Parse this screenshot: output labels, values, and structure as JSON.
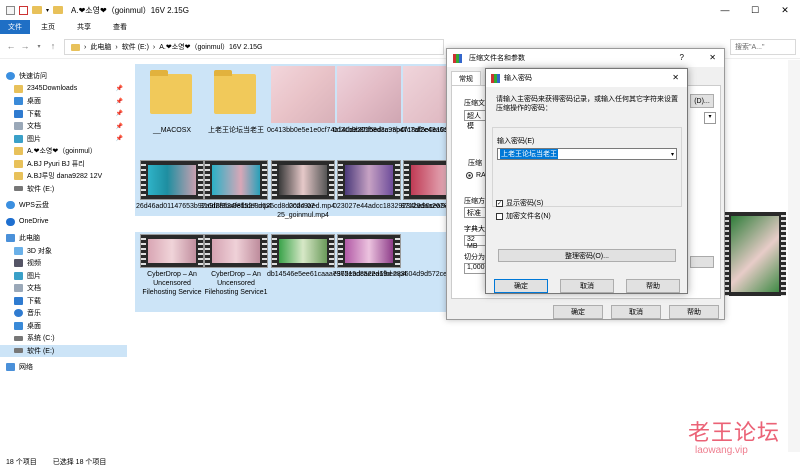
{
  "window": {
    "title": "A.❤소영❤（goinmul）16V 2.15G",
    "minimize": "—",
    "maximize": "☐",
    "close": "✕"
  },
  "ribbon": {
    "tabs": [
      "文件",
      "主页",
      "共享",
      "查看"
    ]
  },
  "address": {
    "path": [
      "此电脑",
      "软件 (E:)",
      "A.❤소영❤（goinmul）16V 2.15G"
    ],
    "search_placeholder": "搜索\"A...\""
  },
  "sidebar": {
    "items": [
      {
        "label": "快速访问",
        "pinned": false
      },
      {
        "label": "2345Downloads",
        "pinned": true
      },
      {
        "label": "桌面",
        "pinned": true
      },
      {
        "label": "下载",
        "pinned": true
      },
      {
        "label": "文档",
        "pinned": true
      },
      {
        "label": "图片",
        "pinned": true
      },
      {
        "label": "A.❤소영❤（goinmul）",
        "pinned": false
      },
      {
        "label": "A.BJ Pyuri BJ 퓨리",
        "pinned": false
      },
      {
        "label": "A.BJ루밍 dana9282 12V",
        "pinned": false
      },
      {
        "label": "软件 (E:)",
        "pinned": false
      },
      {
        "label": "WPS云盘",
        "pinned": false
      },
      {
        "label": "OneDrive",
        "pinned": false
      },
      {
        "label": "此电脑",
        "pinned": false
      },
      {
        "label": "3D 对象",
        "pinned": false
      },
      {
        "label": "视频",
        "pinned": false
      },
      {
        "label": "图片",
        "pinned": false
      },
      {
        "label": "文档",
        "pinned": false
      },
      {
        "label": "下载",
        "pinned": false
      },
      {
        "label": "音乐",
        "pinned": false
      },
      {
        "label": "桌面",
        "pinned": false
      },
      {
        "label": "系统 (C:)",
        "pinned": false
      },
      {
        "label": "软件 (E:)",
        "pinned": false
      },
      {
        "label": "网络",
        "pinned": false
      }
    ]
  },
  "files": [
    {
      "name": "__MACOSX",
      "kind": "folder"
    },
    {
      "name": "上老王论坛当老王",
      "kind": "folder"
    },
    {
      "name": "0c413bb0e5e1e0cf74c140de201b8d3a.mp4",
      "kind": "video-pink"
    },
    {
      "name": "0d3cb9b85f5edcc93bc718df5e0e109b.mp4",
      "kind": "video-pink"
    },
    {
      "name": "0fc7af2e43a6c84dfaec974b.mp4",
      "kind": "video-pink"
    },
    {
      "name": "26d46ad01147653b92a9f28534fe1527.mp4",
      "kind": "video-film"
    },
    {
      "name": "316d6f9ba98fbde8d625cd8d0cdc9aed.mp4",
      "kind": "video-film"
    },
    {
      "name": "2024-07-25_goinmul.mp4",
      "kind": "video-film"
    },
    {
      "name": "023027e44adcc18329234ba90cea9414.mp4",
      "kind": "video-film"
    },
    {
      "name": "87129daa2678a254825e5bd0.mp4",
      "kind": "video-film"
    },
    {
      "name": "CyberDrop – An Uncensored Filehosting Service",
      "kind": "video-film"
    },
    {
      "name": "CyberDrop – An Uncensored Filehosting Service1",
      "kind": "video-film"
    },
    {
      "name": "db14546e5ee61caaa7975e9d852ea19d.mp4",
      "kind": "video-film"
    },
    {
      "name": "e3621adcae2d6fbe283604d9d572ce8d.mp4",
      "kind": "video-film"
    }
  ],
  "status": {
    "count": "18 个项目",
    "selected": "已选择 18 个项目"
  },
  "archive_dialog": {
    "title": "压缩文件名和参数",
    "help_glyph": "?",
    "close": "✕",
    "tab": "常规",
    "labels": [
      "压缩文",
      "超人模",
      "压缩",
      "压缩方",
      "标准",
      "字典大",
      "32 MB",
      "切分为",
      "1,000"
    ],
    "option_rar": "RA",
    "partial_button": "(D)...",
    "ok": "确定",
    "cancel": "取消",
    "help": "帮助"
  },
  "password_dialog": {
    "title": "输入密码",
    "close": "✕",
    "description": "请输入主密码来获得密码记录，或输入任何其它字符来设置压缩操作的密码：",
    "input_label": "输入密码(E)",
    "input_value": "上老王论坛当老王",
    "show_password": "显示密码(S)",
    "show_password_checked": true,
    "encrypt_names": "加密文件名(N)",
    "encrypt_names_checked": false,
    "organize": "整理密码(O)...",
    "ok": "确定",
    "cancel": "取消",
    "help": "帮助"
  },
  "watermark": {
    "text": "老王论坛",
    "url": "laowang.vip"
  }
}
